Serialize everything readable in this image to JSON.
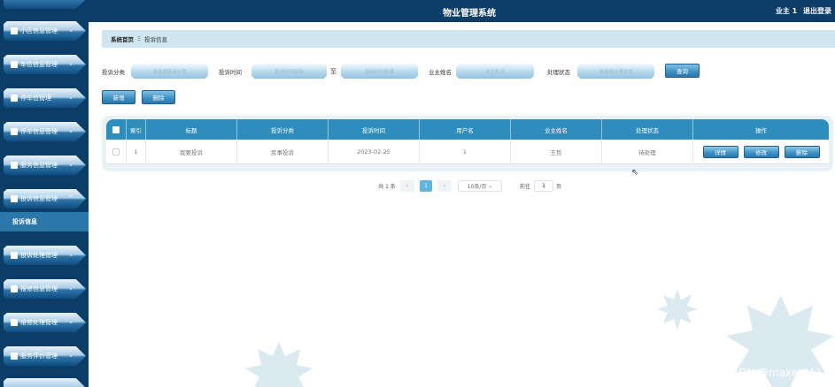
{
  "header": {
    "title": "物业管理系统",
    "user": "业主 1",
    "logout": "退出登录"
  },
  "sidebar": {
    "items": [
      {
        "label": "小区信息管理",
        "icon": "building-icon"
      },
      {
        "label": "车位信息管理",
        "icon": "car-icon"
      },
      {
        "label": "停车位管理",
        "icon": "grid-icon"
      },
      {
        "label": "停车信息管理",
        "icon": "list-icon"
      },
      {
        "label": "服务信息管理",
        "icon": "doc-icon"
      },
      {
        "label": "投诉信息管理",
        "icon": "doc-icon"
      },
      {
        "label": "投诉处理管理",
        "icon": "grid-icon"
      },
      {
        "label": "报修信息管理",
        "icon": "grid-icon"
      },
      {
        "label": "维修处理管理",
        "icon": "grid-icon"
      },
      {
        "label": "服务评价管理",
        "icon": "grid-icon"
      }
    ],
    "active_sub": "投诉信息"
  },
  "breadcrumb": {
    "home": "系统首页",
    "sep": "Ξ",
    "current": "投诉信息"
  },
  "search": {
    "category_label": "投诉分类",
    "category_placeholder": "请选择投诉分类",
    "time_label": "投诉时间",
    "time_start_placeholder": "投诉时间起始",
    "to": "至",
    "time_end_placeholder": "投诉时间结束",
    "owner_label": "业主姓名",
    "owner_placeholder": "业主姓名",
    "status_label": "处理状态",
    "status_placeholder": "请选择处理状态",
    "query_button": "查询"
  },
  "actions": {
    "add": "新增",
    "delete": "删除"
  },
  "table": {
    "headers": [
      "索引",
      "标题",
      "投诉分类",
      "投诉时间",
      "用户名",
      "业主姓名",
      "处理状态",
      "操作"
    ],
    "rows": [
      {
        "index": "1",
        "title": "我要投诉",
        "category": "民事投诉",
        "time": "2023-02-25",
        "username": "1",
        "owner": "王哲",
        "status": "待处理"
      }
    ],
    "op_labels": {
      "detail": "详情",
      "edit": "修改",
      "delete": "删除"
    }
  },
  "pagination": {
    "total": "共 1 条",
    "prev": "‹",
    "current": "1",
    "next": "›",
    "page_size": "10条/页",
    "goto_label": "前往",
    "goto_value": "1",
    "page_unit": "页"
  },
  "watermark": "CSDN @maker011",
  "colors": {
    "navy": "#0b3d66",
    "accent": "#2f8dbd",
    "breadcrumb_bg": "#cfe6f1"
  }
}
